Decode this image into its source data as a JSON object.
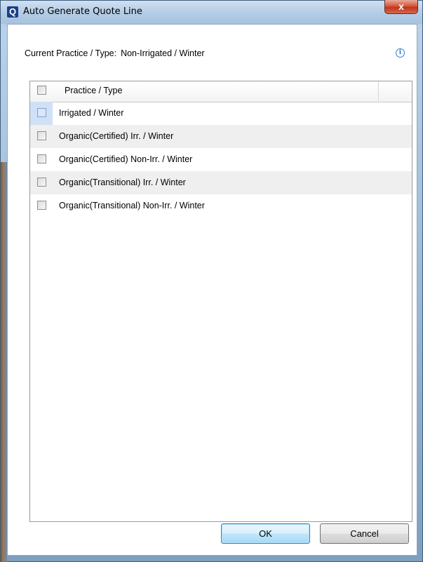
{
  "window": {
    "title": "Auto Generate Quote Line",
    "app_icon_letter": "Q",
    "close_glyph": "x"
  },
  "current": {
    "label": "Current Practice / Type:",
    "value": "Non-Irrigated / Winter",
    "info_icon": "info-icon"
  },
  "grid": {
    "header": "Practice / Type",
    "rows": [
      {
        "label": "Irrigated / Winter",
        "checked": false
      },
      {
        "label": "Organic(Certified) Irr. / Winter",
        "checked": false
      },
      {
        "label": "Organic(Certified) Non-Irr. / Winter",
        "checked": false
      },
      {
        "label": "Organic(Transitional) Irr. / Winter",
        "checked": false
      },
      {
        "label": "Organic(Transitional) Non-Irr. / Winter",
        "checked": false
      }
    ]
  },
  "buttons": {
    "ok": "OK",
    "cancel": "Cancel"
  }
}
